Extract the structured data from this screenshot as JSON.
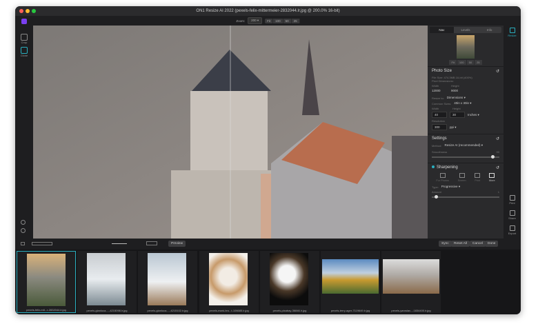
{
  "window": {
    "title": "ON1 Resize AI 2022 (pexels-felix-mittermeier-2832044.lr.jpg @ 200.0% 16-bit)"
  },
  "toolbar": {
    "zoom_label": "Zoom:",
    "zoom_value": "200",
    "zoom_buttons": [
      "Fit",
      "100",
      "50",
      "25"
    ]
  },
  "tools": [
    {
      "label": "Crop"
    },
    {
      "label": "Clone"
    }
  ],
  "panel": {
    "tabs": [
      "Nav",
      "Levels",
      "Info"
    ],
    "nav_buttons": [
      "Fit",
      "100",
      "50",
      "25"
    ],
    "photo_size": {
      "title": "Photo Size",
      "file_size": "File Size: 474.3MB 16-bit (400%)",
      "pixel_dims": "Pixel Dimensions:",
      "width_label": "Width",
      "height_label": "Height",
      "width": "12000",
      "height": "9000",
      "resize_to_label": "Resize to:",
      "resize_to": "Dimensions",
      "common_sizes_label": "Common Sizes:",
      "common_size": "40in x 30in",
      "doc_width_label": "Width",
      "doc_height_label": "Height",
      "doc_width": "40",
      "doc_height": "30",
      "unit": "Inches",
      "resolution_label": "Resolution",
      "resolution": "300",
      "res_unit": "ppi"
    },
    "settings": {
      "title": "Settings",
      "method_label": "Method:",
      "method": "Resize AI (recommended)",
      "smoothness_label": "Smoothness",
      "smoothness": "90"
    },
    "sharpening": {
      "title": "Sharpening",
      "presets": [
        "For Photos",
        "Screen",
        "Print",
        "More"
      ],
      "type_label": "Type:",
      "type": "Progressive",
      "amount_label": "Amount",
      "amount": "1"
    }
  },
  "right_column": {
    "resize_label": "Resize",
    "print_label": "Print",
    "share_label": "Share",
    "export_label": "Export"
  },
  "bottom": {
    "preview": "Preview",
    "sync": "Sync",
    "reset_all": "Reset All",
    "cancel": "Cancel",
    "done": "Done"
  },
  "filmstrip": [
    {
      "name": "pexels-felix-mit...r-2832044.lr.jpg"
    },
    {
      "name": "pexels-gianluca-...-4215098.lr.jpg"
    },
    {
      "name": "pexels-gianluca-...-4215102.lr.jpg"
    },
    {
      "name": "pexels-mark-bro...t-106685.lr.jpg"
    },
    {
      "name": "pexels-pixabay-36846.lr.jpg"
    },
    {
      "name": "pexels-terry-ager-7119649.lr.jpg"
    },
    {
      "name": "pexels-yaroslav...-1834400.lr.jpg"
    }
  ],
  "colors": {
    "accent": "#2ab0c0",
    "brand": "#7a3ff0"
  }
}
